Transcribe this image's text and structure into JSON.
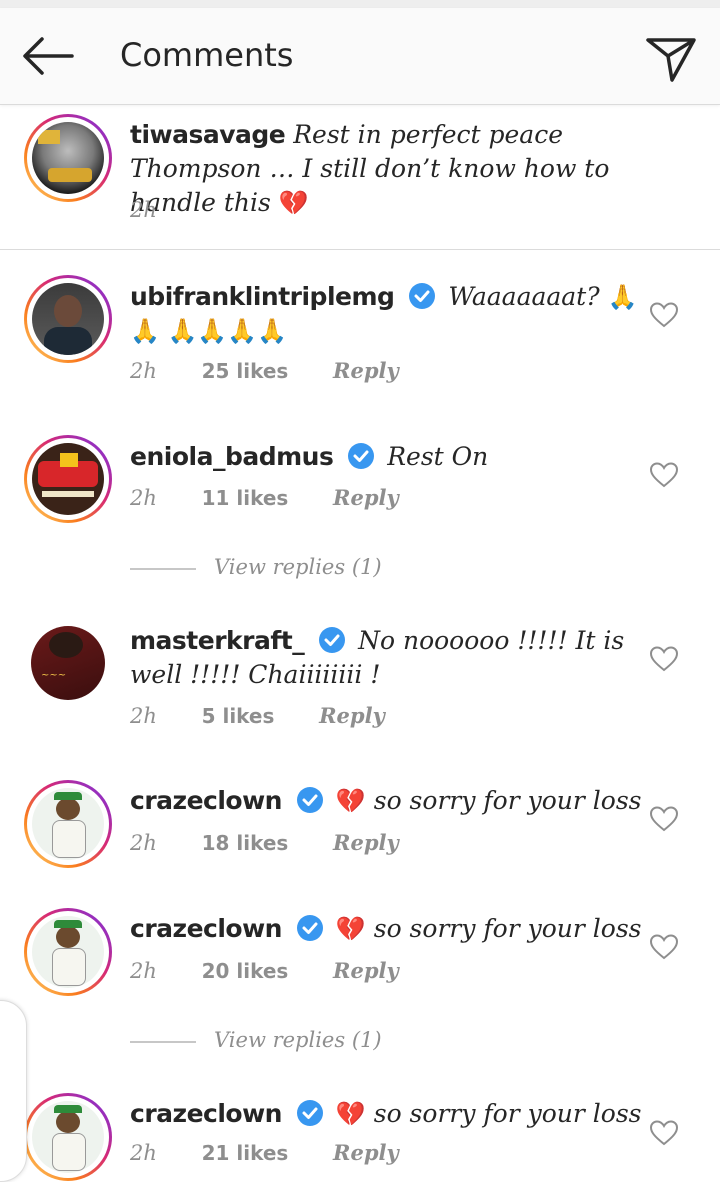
{
  "header": {
    "title": "Comments"
  },
  "caption": {
    "username": "tiwasavage",
    "text": "Rest in perfect peace Thompson … I still don’t know how to handle this",
    "emoji": "💔",
    "time": "2h"
  },
  "comments": [
    {
      "username": "ubifranklintriplemg",
      "verified": true,
      "text": "Waaaaaaat?",
      "emoji": "🙏🙏 🙏🙏🙏🙏",
      "time": "2h",
      "likes": "25 likes",
      "reply": "Reply"
    },
    {
      "username": "eniola_badmus",
      "verified": true,
      "text": "Rest On",
      "emoji": "",
      "time": "2h",
      "likes": "11 likes",
      "reply": "Reply",
      "view_replies": "View replies (1)"
    },
    {
      "username": "masterkraft_",
      "verified": true,
      "text": "No noooooo !!!!! It is well !!!!! Chaiiiiiiii !",
      "emoji": "",
      "time": "2h",
      "likes": "5 likes",
      "reply": "Reply"
    },
    {
      "username": "crazeclown",
      "verified": true,
      "text": "so sorry for your loss",
      "emoji": "💔",
      "time": "2h",
      "likes": "18 likes",
      "reply": "Reply"
    },
    {
      "username": "crazeclown",
      "verified": true,
      "text": "so sorry for your loss",
      "emoji": "💔",
      "time": "2h",
      "likes": "20 likes",
      "reply": "Reply",
      "view_replies": "View replies (1)"
    },
    {
      "username": "crazeclown",
      "verified": true,
      "text": "so sorry for your loss",
      "emoji": "💔",
      "time": "2h",
      "likes": "21 likes",
      "reply": "Reply"
    }
  ],
  "colors": {
    "verified": "#3897f0",
    "meta": "#8e8e8e",
    "text": "#262626",
    "heart_broken": "#e0245e"
  },
  "icons": {
    "back": "arrow-left-icon",
    "send": "paper-plane-icon",
    "like": "heart-outline-icon",
    "verified": "verified-badge-icon"
  }
}
